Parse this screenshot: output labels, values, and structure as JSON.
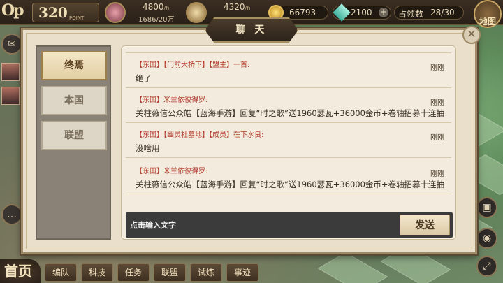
{
  "topbar": {
    "op_label": "Op",
    "points_value": "320",
    "points_label": "POINT",
    "resource1_value": "4800",
    "resource1_unit": "/h",
    "resource1_sub": "1686/20万",
    "resource2_value": "4320",
    "resource2_unit": "/h",
    "gold_value": "66793",
    "gem_value": "2100",
    "territory_label": "占领数",
    "territory_value": "28/30",
    "map_label": "地图"
  },
  "dialog": {
    "title": "聊 天",
    "close_glyph": "✕",
    "tabs": [
      {
        "label": "终焉",
        "active": true
      },
      {
        "label": "本国",
        "active": false
      },
      {
        "label": "联盟",
        "active": false
      }
    ],
    "messages": [
      {
        "header": "【东国】【门前大桥下】【盟主】一首:",
        "time": "刚刚",
        "text": "绝了"
      },
      {
        "header": "【东国】米兰依彼得罗:",
        "time": "刚刚",
        "text": "关柱薇信公众皓【蓝海手游】回复“时之歌”送1960瑟瓦+36000金币+卷轴招募十连抽"
      },
      {
        "header": "【东国】【幽灵社墓地】【成员】在下水良:",
        "time": "刚刚",
        "text": "没啥用"
      },
      {
        "header": "【东国】米兰依彼得罗:",
        "time": "刚刚",
        "text": "关柱薇信公众皓【蓝海手游】回复“时之歌”送1960瑟瓦+36000金币+卷轴招募十连抽"
      }
    ],
    "input_placeholder": "点击输入文字",
    "send_label": "发送"
  },
  "bottom_nav": {
    "home_label": "首页",
    "items": [
      "编队",
      "科技",
      "任务",
      "联盟",
      "试炼",
      "事迹"
    ]
  },
  "icons": {
    "mail": "mail-icon",
    "chat": "chat-icon",
    "bag": "bag-icon",
    "location": "location-icon",
    "fullscreen": "fullscreen-icon"
  }
}
